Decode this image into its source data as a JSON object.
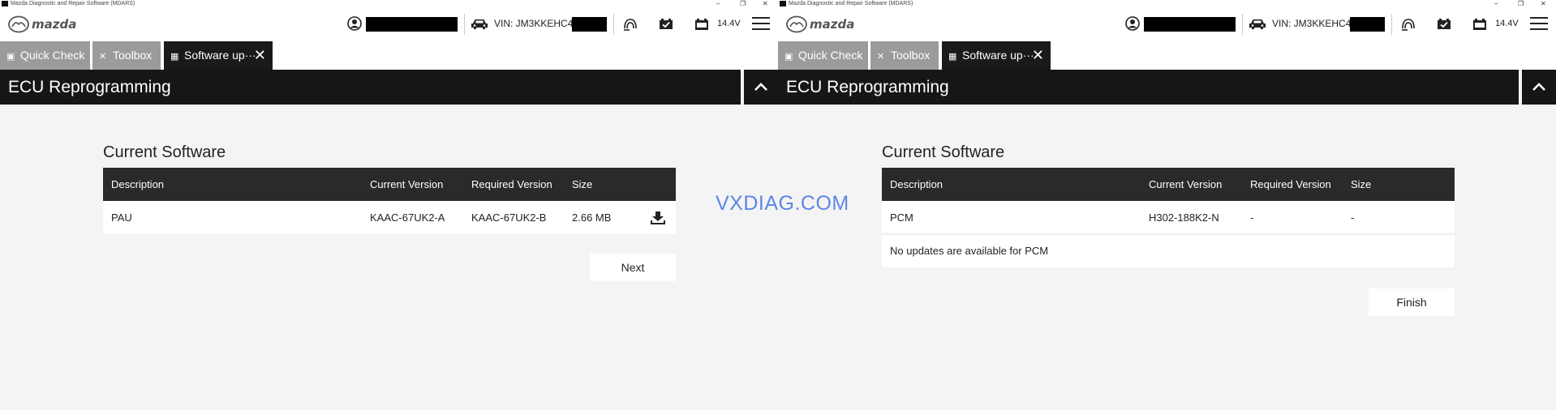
{
  "app": {
    "window_title": "Mazda Diagnostic and Repair Software (MDARS)",
    "logo_text": "mazda",
    "vin": "VIN: JM3KKEHC4R",
    "voltage": "14.4V"
  },
  "tabs": [
    {
      "label": "Quick Check",
      "icon": "toolbox-icon",
      "state": "inactive"
    },
    {
      "label": "Toolbox",
      "icon": "wrench-screwdriver-icon",
      "state": "inactive"
    },
    {
      "label": "Software up···",
      "icon": "chip-icon",
      "state": "active"
    }
  ],
  "page_title": "ECU Reprogramming",
  "left_pane": {
    "section_title": "Current Software",
    "columns": [
      "Description",
      "Current Version",
      "Required Version",
      "Size"
    ],
    "rows": [
      {
        "description": "PAU",
        "current": "KAAC-67UK2-A",
        "required": "KAAC-67UK2-B",
        "size": "2.66 MB"
      }
    ],
    "button": "Next"
  },
  "right_pane": {
    "section_title": "Current Software",
    "columns": [
      "Description",
      "Current Version",
      "Required Version",
      "Size"
    ],
    "rows": [
      {
        "description": "PCM",
        "current": "H302-188K2-N",
        "required": "-",
        "size": "-"
      }
    ],
    "note": "No updates are available for PCM",
    "button": "Finish"
  },
  "watermark": "VXDIAG.COM",
  "colors": {
    "header_bar": "#161616",
    "table_head": "#2a2a2a",
    "tab_inactive": "#9b9b9b",
    "watermark": "#5c86e6",
    "background": "#f4f4f4"
  }
}
